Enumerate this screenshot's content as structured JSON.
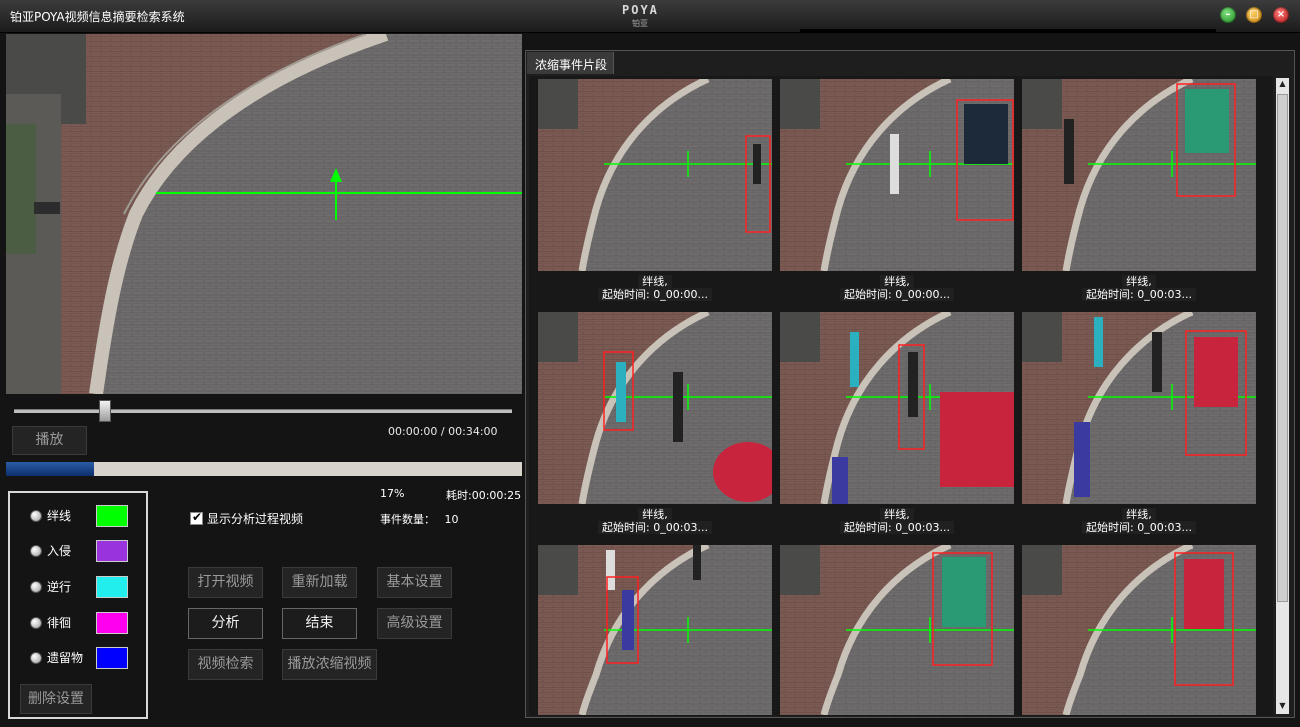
{
  "window": {
    "title": "铂亚POYA视频信息摘要检索系统",
    "logo_mark": "POYA",
    "logo_sub": "铂亚"
  },
  "colors": {
    "tripwire": "#00ff00",
    "intrusion": "#9933dd",
    "retrograde": "#22eeee",
    "loitering": "#ff00ee",
    "left_object": "#0000ff",
    "event_box": "#ff2020"
  },
  "player": {
    "play_label": "播放",
    "current_time": "00:00:00",
    "separator": "/",
    "total_time": "00:34:00",
    "seek_fraction": 0.18,
    "progress_fraction": 0.17
  },
  "status": {
    "percent": "17%",
    "elapsed_label": "耗时:",
    "elapsed_value": "00:00:25",
    "event_count_label": "事件数量：",
    "event_count_value": "10"
  },
  "events": [
    {
      "label": "绊线",
      "color": "#00ff00"
    },
    {
      "label": "入侵",
      "color": "#9933dd"
    },
    {
      "label": "逆行",
      "color": "#22eeee"
    },
    {
      "label": "徘徊",
      "color": "#ff00ee"
    },
    {
      "label": "遗留物",
      "color": "#0000ff"
    }
  ],
  "delete_settings_label": "删除设置",
  "show_analysis_label": "显示分析过程视频",
  "buttons": {
    "open_video": "打开视频",
    "reload": "重新加载",
    "basic_settings": "基本设置",
    "analyze": "分析",
    "end": "结束",
    "advanced_settings": "高级设置",
    "video_search": "视频检索",
    "play_condensed": "播放浓缩视频"
  },
  "panel": {
    "tab_label": "浓缩事件片段"
  },
  "clips": [
    {
      "type": "绊线,",
      "start": "起始时间: 0_00:00..."
    },
    {
      "type": "绊线,",
      "start": "起始时间: 0_00:00..."
    },
    {
      "type": "绊线,",
      "start": "起始时间: 0_00:03..."
    },
    {
      "type": "绊线,",
      "start": "起始时间: 0_00:03..."
    },
    {
      "type": "绊线,",
      "start": "起始时间: 0_00:03..."
    },
    {
      "type": "绊线,",
      "start": "起始时间: 0_00:03..."
    },
    {
      "type": "",
      "start": ""
    },
    {
      "type": "",
      "start": ""
    },
    {
      "type": "",
      "start": ""
    }
  ]
}
